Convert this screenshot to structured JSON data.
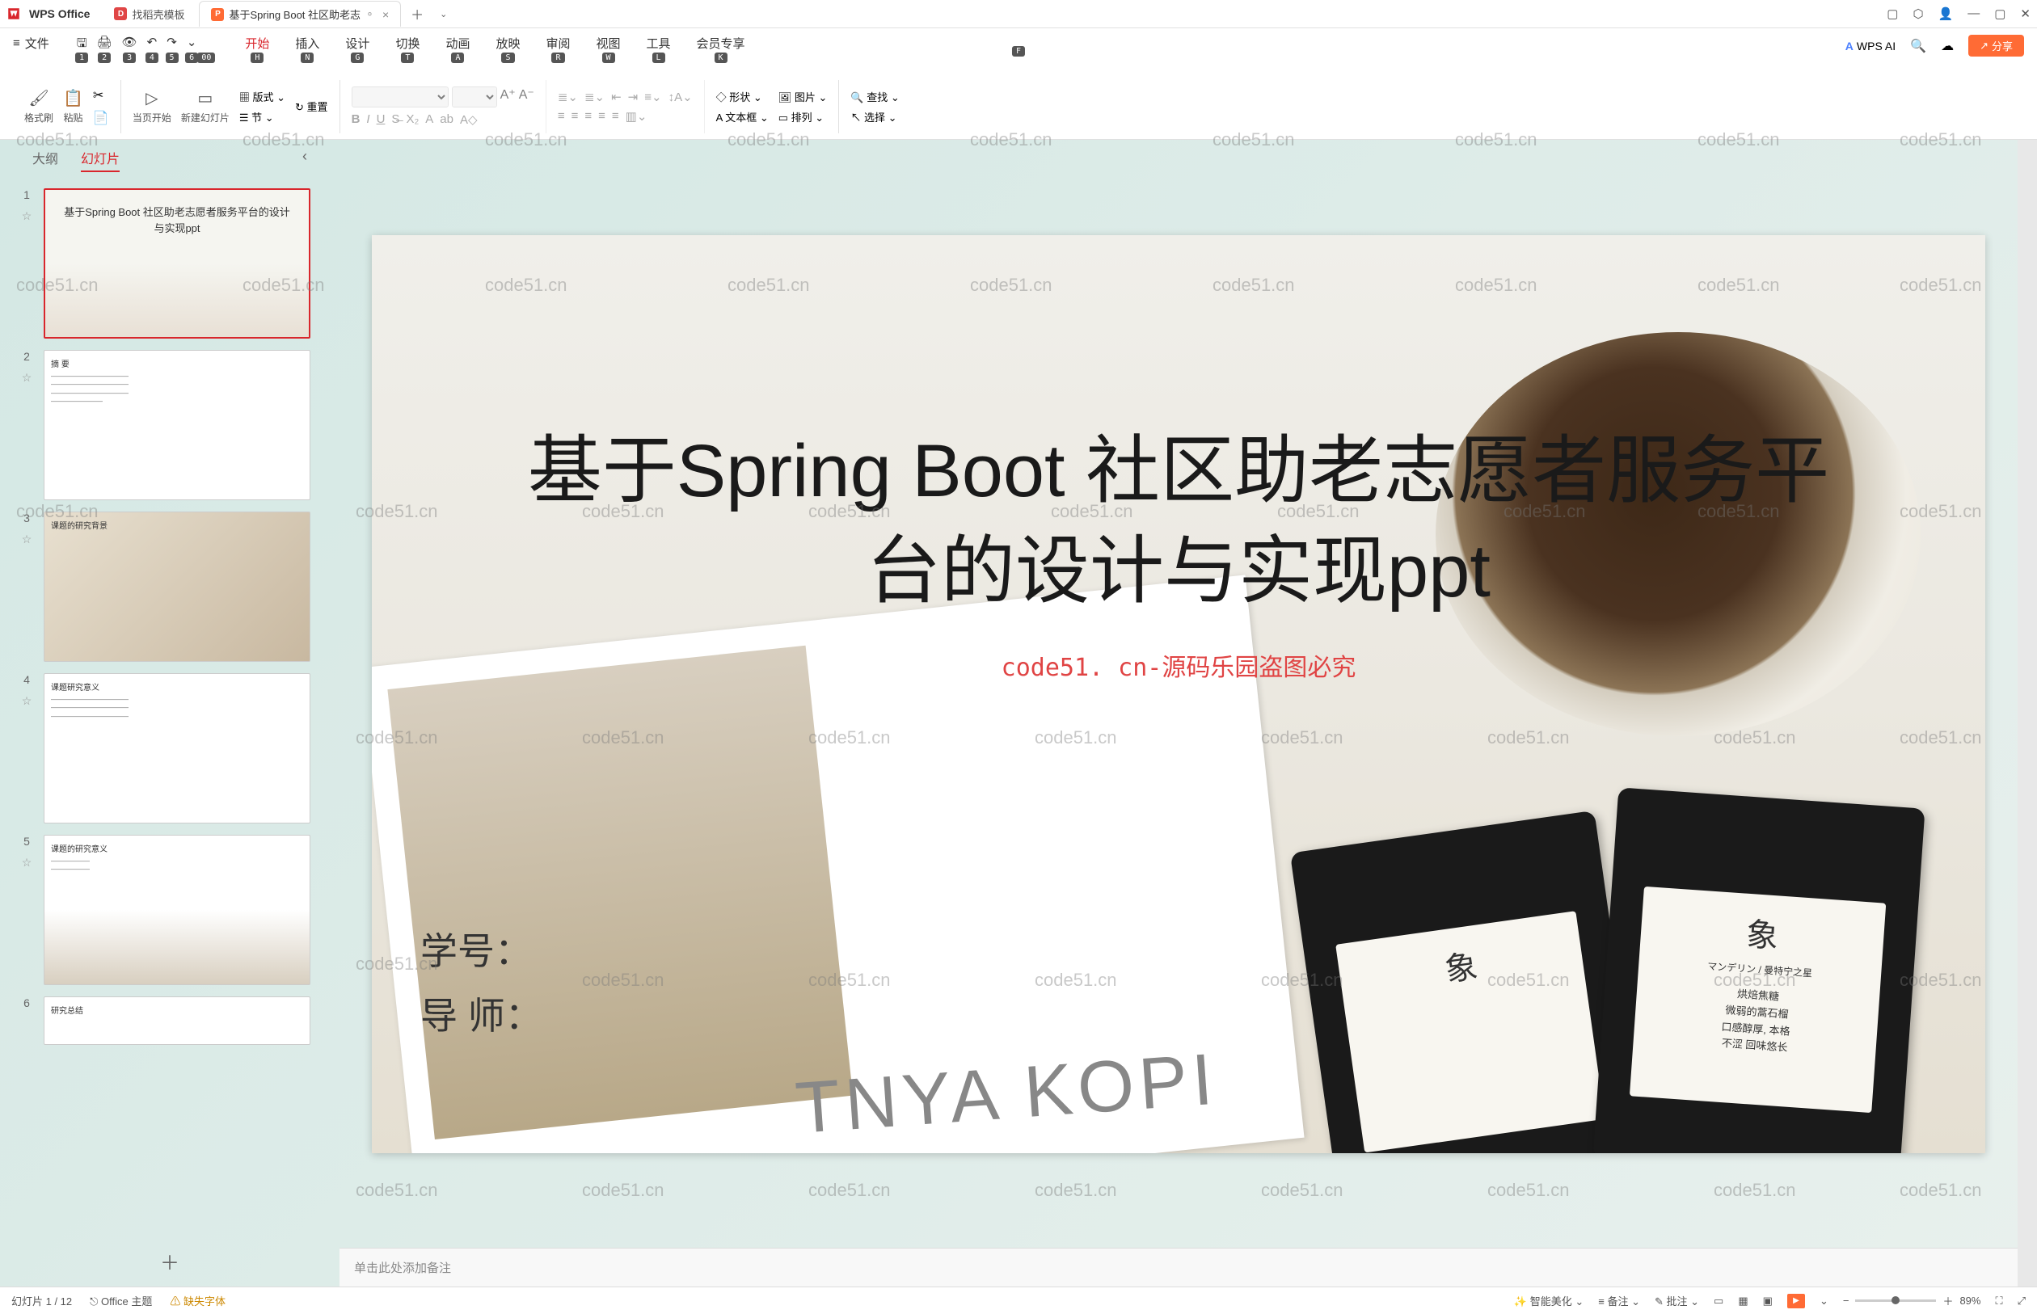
{
  "app": {
    "name": "WPS Office"
  },
  "documentTabs": [
    {
      "label": "找稻壳模板",
      "active": false,
      "iconLetter": "D"
    },
    {
      "label": "基于Spring Boot 社区助老志",
      "active": true,
      "iconLetter": "P"
    }
  ],
  "menuFile": "文件",
  "keyHints": {
    "file": "F",
    "q1": "1",
    "q2": "2",
    "q3": "3",
    "q4": "4",
    "q5": "5",
    "q6": "6",
    "q7": "00",
    "start": "H",
    "insert": "N",
    "design": "G",
    "trans": "T",
    "anim": "A",
    "show": "S",
    "review": "R",
    "view": "W",
    "tool": "L",
    "member": "K"
  },
  "menuTabs": {
    "start": "开始",
    "insert": "插入",
    "design": "设计",
    "transition": "切换",
    "animation": "动画",
    "show": "放映",
    "review": "审阅",
    "view": "视图",
    "tool": "工具",
    "member": "会员专享"
  },
  "wpsAI": "WPS AI",
  "shareLabel": "分享",
  "ribbon": {
    "format": "格式刷",
    "paste": "粘贴",
    "fromCurrent": "当页开始",
    "newSlide": "新建幻灯片",
    "layouts": "版式",
    "section": "节",
    "reset": "重置",
    "shape": "形状",
    "image": "图片",
    "textbox": "文本框",
    "arrange": "排列",
    "find": "查找",
    "select": "选择"
  },
  "viewTabs": {
    "outline": "大纲",
    "slides": "幻灯片"
  },
  "thumbnails": [
    {
      "n": "1",
      "title": "基于Spring Boot 社区助老志愿者服务平台的设计与实现ppt",
      "kind": "title"
    },
    {
      "n": "2",
      "title": "摘 要",
      "kind": "text"
    },
    {
      "n": "3",
      "title": "课题的研究背景",
      "kind": "image"
    },
    {
      "n": "4",
      "title": "课题研究意义",
      "kind": "text"
    },
    {
      "n": "5",
      "title": "课题的研究意义",
      "kind": "mixed"
    },
    {
      "n": "6",
      "title": "研究总结",
      "kind": "text"
    }
  ],
  "slide": {
    "title": "基于Spring Boot 社区助老志愿者服务平台的设计与实现ppt",
    "watermark": "code51. cn-源码乐园盗图必究",
    "field1": "学号：",
    "field2": "导 师：",
    "magazineText": "TNYA KOPI",
    "bagTitle": "象",
    "bagSub": "マンデリン / 曼特宁之星",
    "bagLines": "烘焙焦糖\n微弱的蒿石榴\n口感醇厚, 本格\n不涩 回味悠长"
  },
  "notesPlaceholder": "单击此处添加备注",
  "status": {
    "slideInfo": "幻灯片 1 / 12",
    "theme": "Office 主题",
    "missingFont": "缺失字体",
    "beautify": "智能美化",
    "notes": "备注",
    "comments": "批注",
    "zoom": "89%"
  },
  "watermarkText": "code51.cn"
}
